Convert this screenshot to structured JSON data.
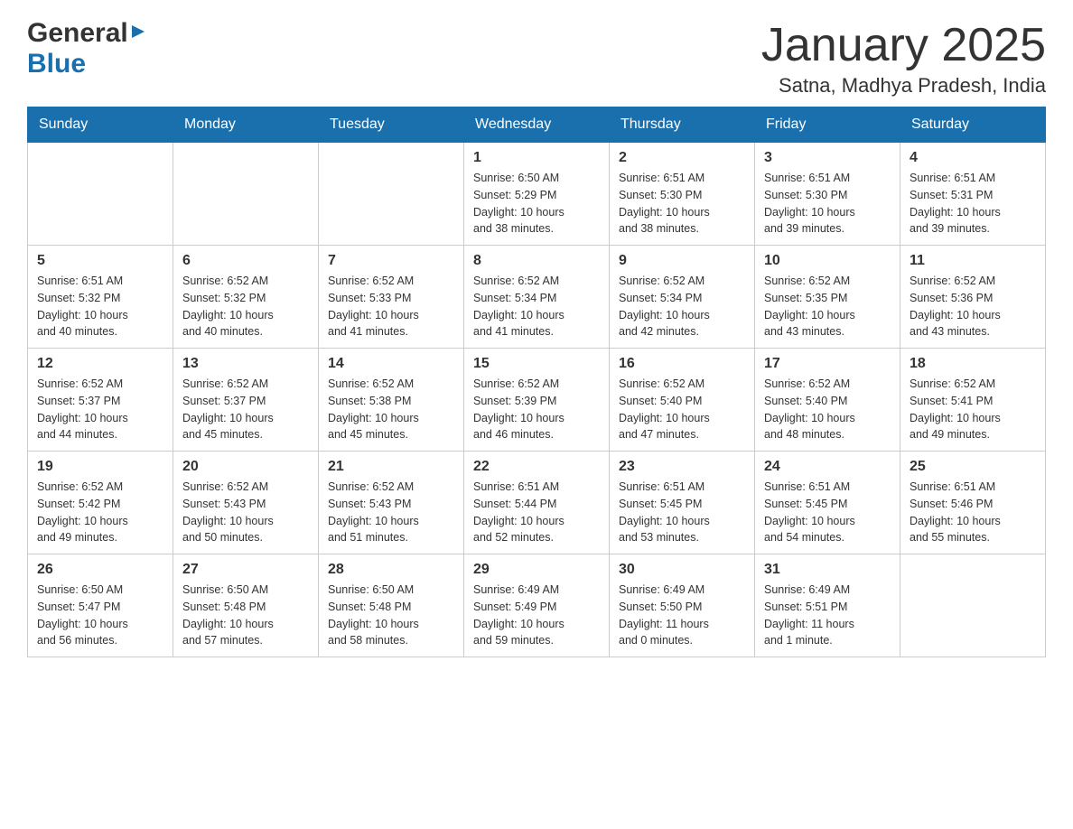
{
  "header": {
    "logo_general": "General",
    "logo_blue": "Blue",
    "month_title": "January 2025",
    "location": "Satna, Madhya Pradesh, India"
  },
  "days_of_week": [
    "Sunday",
    "Monday",
    "Tuesday",
    "Wednesday",
    "Thursday",
    "Friday",
    "Saturday"
  ],
  "weeks": [
    [
      {
        "day": "",
        "info": ""
      },
      {
        "day": "",
        "info": ""
      },
      {
        "day": "",
        "info": ""
      },
      {
        "day": "1",
        "info": "Sunrise: 6:50 AM\nSunset: 5:29 PM\nDaylight: 10 hours\nand 38 minutes."
      },
      {
        "day": "2",
        "info": "Sunrise: 6:51 AM\nSunset: 5:30 PM\nDaylight: 10 hours\nand 38 minutes."
      },
      {
        "day": "3",
        "info": "Sunrise: 6:51 AM\nSunset: 5:30 PM\nDaylight: 10 hours\nand 39 minutes."
      },
      {
        "day": "4",
        "info": "Sunrise: 6:51 AM\nSunset: 5:31 PM\nDaylight: 10 hours\nand 39 minutes."
      }
    ],
    [
      {
        "day": "5",
        "info": "Sunrise: 6:51 AM\nSunset: 5:32 PM\nDaylight: 10 hours\nand 40 minutes."
      },
      {
        "day": "6",
        "info": "Sunrise: 6:52 AM\nSunset: 5:32 PM\nDaylight: 10 hours\nand 40 minutes."
      },
      {
        "day": "7",
        "info": "Sunrise: 6:52 AM\nSunset: 5:33 PM\nDaylight: 10 hours\nand 41 minutes."
      },
      {
        "day": "8",
        "info": "Sunrise: 6:52 AM\nSunset: 5:34 PM\nDaylight: 10 hours\nand 41 minutes."
      },
      {
        "day": "9",
        "info": "Sunrise: 6:52 AM\nSunset: 5:34 PM\nDaylight: 10 hours\nand 42 minutes."
      },
      {
        "day": "10",
        "info": "Sunrise: 6:52 AM\nSunset: 5:35 PM\nDaylight: 10 hours\nand 43 minutes."
      },
      {
        "day": "11",
        "info": "Sunrise: 6:52 AM\nSunset: 5:36 PM\nDaylight: 10 hours\nand 43 minutes."
      }
    ],
    [
      {
        "day": "12",
        "info": "Sunrise: 6:52 AM\nSunset: 5:37 PM\nDaylight: 10 hours\nand 44 minutes."
      },
      {
        "day": "13",
        "info": "Sunrise: 6:52 AM\nSunset: 5:37 PM\nDaylight: 10 hours\nand 45 minutes."
      },
      {
        "day": "14",
        "info": "Sunrise: 6:52 AM\nSunset: 5:38 PM\nDaylight: 10 hours\nand 45 minutes."
      },
      {
        "day": "15",
        "info": "Sunrise: 6:52 AM\nSunset: 5:39 PM\nDaylight: 10 hours\nand 46 minutes."
      },
      {
        "day": "16",
        "info": "Sunrise: 6:52 AM\nSunset: 5:40 PM\nDaylight: 10 hours\nand 47 minutes."
      },
      {
        "day": "17",
        "info": "Sunrise: 6:52 AM\nSunset: 5:40 PM\nDaylight: 10 hours\nand 48 minutes."
      },
      {
        "day": "18",
        "info": "Sunrise: 6:52 AM\nSunset: 5:41 PM\nDaylight: 10 hours\nand 49 minutes."
      }
    ],
    [
      {
        "day": "19",
        "info": "Sunrise: 6:52 AM\nSunset: 5:42 PM\nDaylight: 10 hours\nand 49 minutes."
      },
      {
        "day": "20",
        "info": "Sunrise: 6:52 AM\nSunset: 5:43 PM\nDaylight: 10 hours\nand 50 minutes."
      },
      {
        "day": "21",
        "info": "Sunrise: 6:52 AM\nSunset: 5:43 PM\nDaylight: 10 hours\nand 51 minutes."
      },
      {
        "day": "22",
        "info": "Sunrise: 6:51 AM\nSunset: 5:44 PM\nDaylight: 10 hours\nand 52 minutes."
      },
      {
        "day": "23",
        "info": "Sunrise: 6:51 AM\nSunset: 5:45 PM\nDaylight: 10 hours\nand 53 minutes."
      },
      {
        "day": "24",
        "info": "Sunrise: 6:51 AM\nSunset: 5:45 PM\nDaylight: 10 hours\nand 54 minutes."
      },
      {
        "day": "25",
        "info": "Sunrise: 6:51 AM\nSunset: 5:46 PM\nDaylight: 10 hours\nand 55 minutes."
      }
    ],
    [
      {
        "day": "26",
        "info": "Sunrise: 6:50 AM\nSunset: 5:47 PM\nDaylight: 10 hours\nand 56 minutes."
      },
      {
        "day": "27",
        "info": "Sunrise: 6:50 AM\nSunset: 5:48 PM\nDaylight: 10 hours\nand 57 minutes."
      },
      {
        "day": "28",
        "info": "Sunrise: 6:50 AM\nSunset: 5:48 PM\nDaylight: 10 hours\nand 58 minutes."
      },
      {
        "day": "29",
        "info": "Sunrise: 6:49 AM\nSunset: 5:49 PM\nDaylight: 10 hours\nand 59 minutes."
      },
      {
        "day": "30",
        "info": "Sunrise: 6:49 AM\nSunset: 5:50 PM\nDaylight: 11 hours\nand 0 minutes."
      },
      {
        "day": "31",
        "info": "Sunrise: 6:49 AM\nSunset: 5:51 PM\nDaylight: 11 hours\nand 1 minute."
      },
      {
        "day": "",
        "info": ""
      }
    ]
  ]
}
